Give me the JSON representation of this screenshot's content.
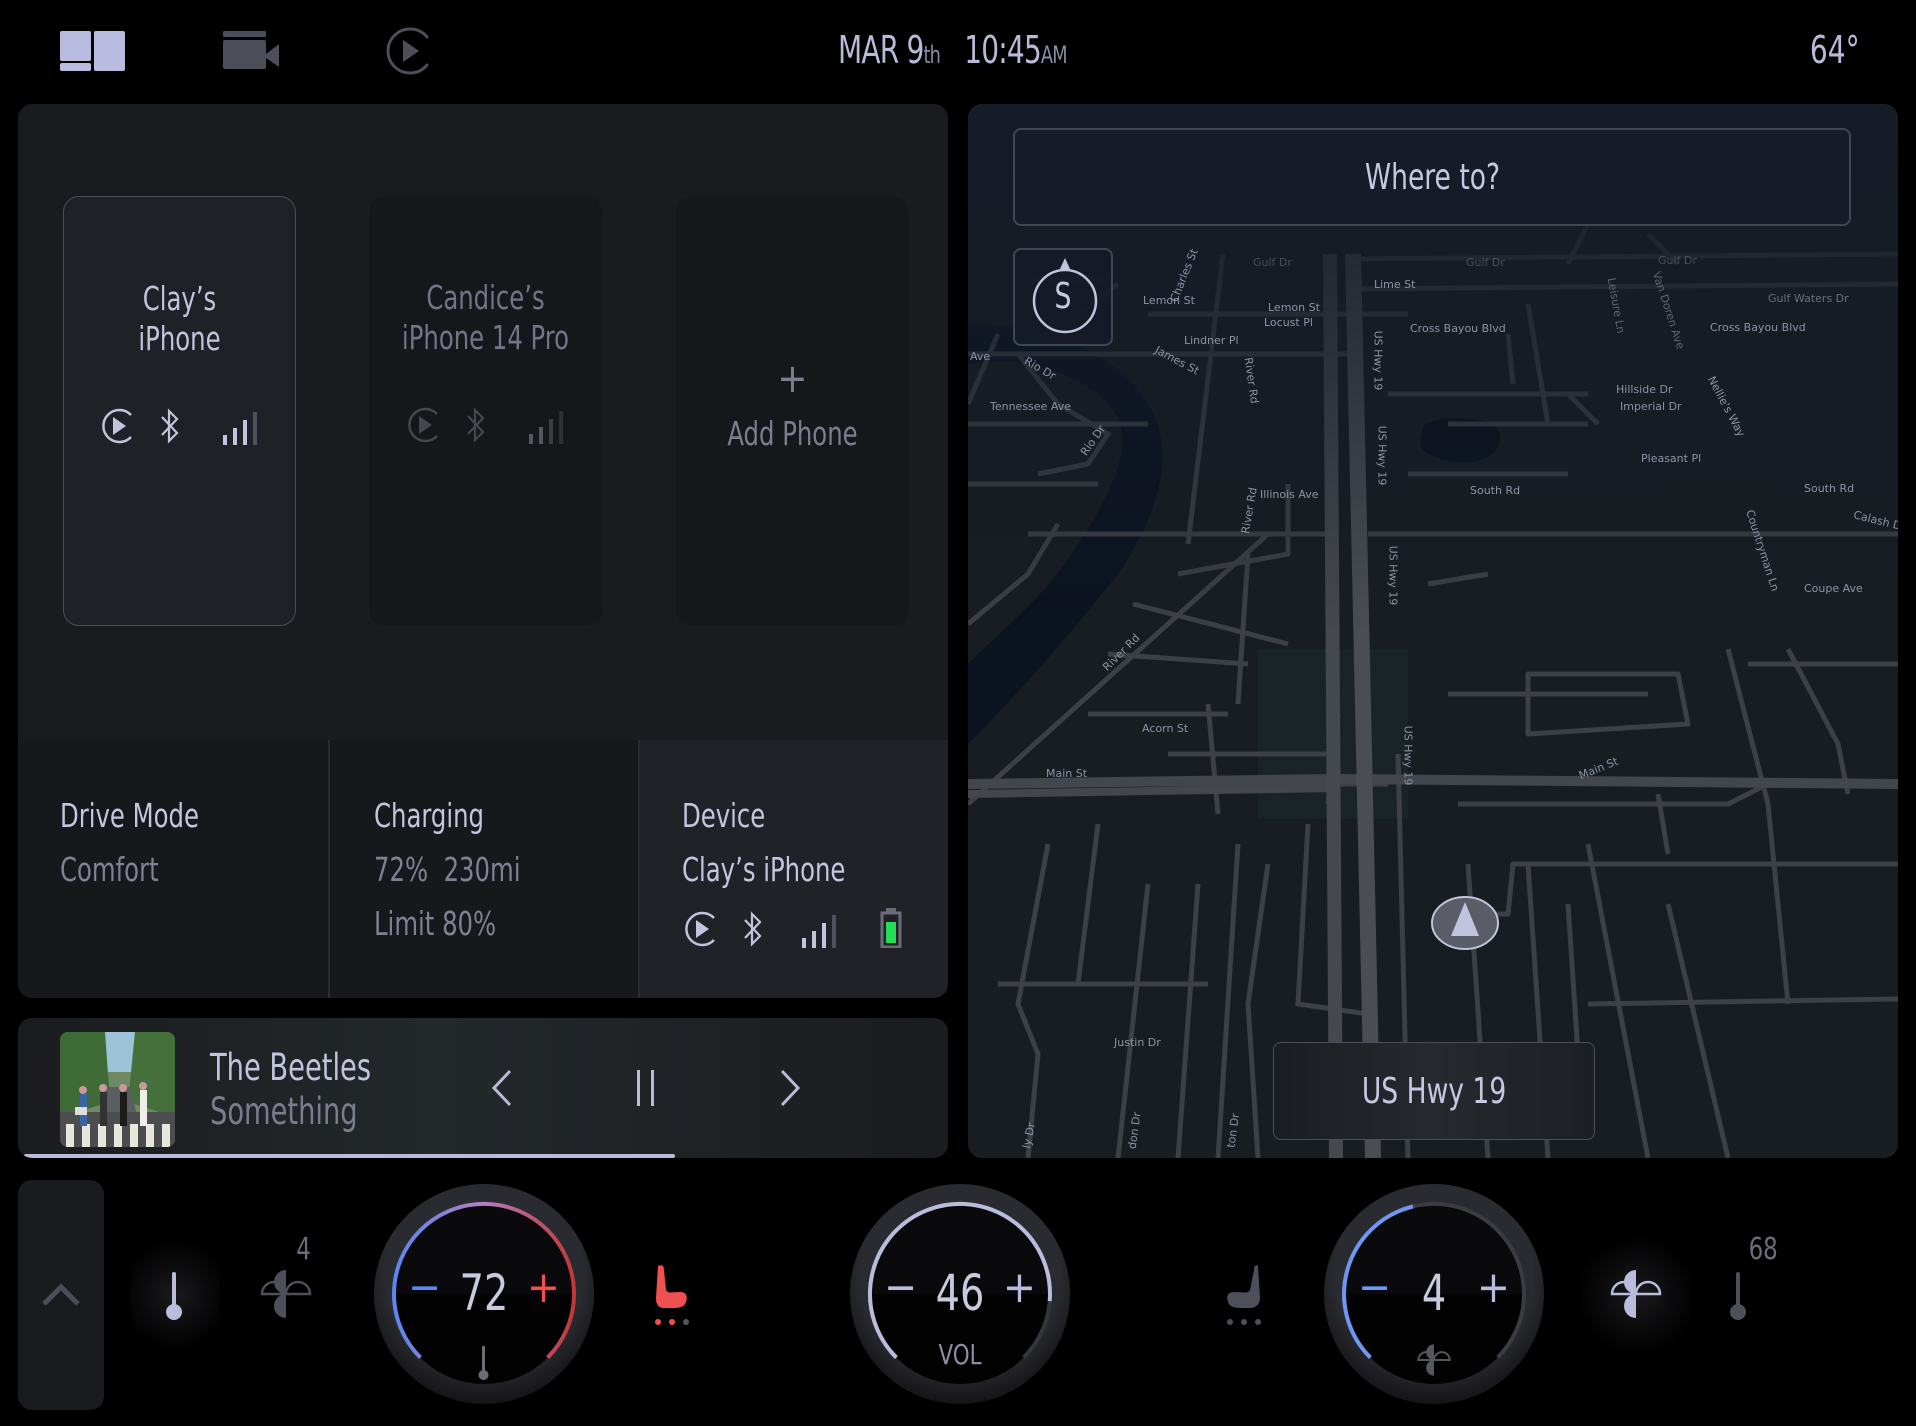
{
  "topbar": {
    "icons": [
      {
        "name": "dashboard-layout-icon",
        "active": true
      },
      {
        "name": "video-camera-icon",
        "active": false
      },
      {
        "name": "media-play-icon",
        "active": false
      }
    ],
    "date_month_day": "MAR 9",
    "date_suffix": "th",
    "time": "10:45",
    "time_suffix": "AM",
    "outside_temp": "64°"
  },
  "phones": [
    {
      "name_line1": "Clay’s",
      "name_line2": "iPhone",
      "state": "active",
      "icons": [
        "carplay-icon",
        "bluetooth-icon",
        "signal-icon"
      ]
    },
    {
      "name_line1": "Candice’s",
      "name_line2": "iPhone 14 Pro",
      "state": "inactive",
      "icons": [
        "carplay-icon",
        "bluetooth-icon",
        "signal-icon"
      ]
    },
    {
      "add_icon": "+",
      "add_label": "Add Phone"
    }
  ],
  "info": {
    "drive_mode": {
      "title": "Drive Mode",
      "value": "Comfort"
    },
    "charging": {
      "title": "Charging",
      "percent": "72%",
      "range": "230mi",
      "limit": "Limit 80%"
    },
    "device": {
      "title": "Device",
      "name": "Clay’s iPhone",
      "battery_color": "#22dd55"
    }
  },
  "media": {
    "artist": "The Beetles",
    "song": "Something",
    "progress": 0.7,
    "prev_icon": "chevron-left-icon",
    "pause_icon": "pause-icon",
    "next_icon": "chevron-right-icon"
  },
  "map": {
    "search_placeholder": "Where to?",
    "compass_label": "S",
    "current_street": "US Hwy 19",
    "labels": {
      "lemon_st_1": "Lemon St",
      "lemon_st_2": "Lemon St",
      "charles_st": "Charles St",
      "lime_st": "Lime St",
      "locust_pl": "Locust Pl",
      "lindner_pl": "Lindner Pl",
      "james_st": "James St",
      "gulf_dr_1": "Gulf Dr",
      "gulf_dr_2": "Gulf Dr",
      "gulf_dr_3": "Gulf Dr",
      "leisure_ln": "Leisure Ln",
      "van_doren_ave": "Van Doren Ave",
      "gulf_waters_dr": "Gulf Waters Dr",
      "cross_bayou_1": "Cross Bayou Blvd",
      "cross_bayou_2": "Cross Bayou Blvd",
      "ave": "Ave",
      "rio_dr_1": "Rio Dr",
      "rio_dr_2": "Rio Dr",
      "tennessee_ave": "Tennessee Ave",
      "river_rd_1": "River Rd",
      "river_rd_2": "River Rd",
      "river_rd_3": "River Rd",
      "us_hwy_19_a": "US Hwy 19",
      "us_hwy_19_b": "US Hwy 19",
      "us_hwy_19_c": "US Hwy 19",
      "us_hwy_19_d": "US Hwy 19",
      "hillside_dr": "Hillside Dr",
      "imperial_dr": "Imperial Dr",
      "nellies_way": "Nellie's Way",
      "pleasant_pl": "Pleasant Pl",
      "illinois_ave": "Illinois Ave",
      "south_rd_1": "South Rd",
      "south_rd_2": "South Rd",
      "calash_dr": "Calash D",
      "countryman_ln": "Countryman Ln",
      "coupe_ave": "Coupe Ave",
      "acorn_st": "Acorn St",
      "main_st_1": "Main St",
      "main_st_2": "Main St",
      "justin_dr": "Justin Dr",
      "bottom_1": "ly Dr",
      "bottom_2": "don Dr",
      "bottom_3": "ton Dr"
    }
  },
  "climate": {
    "collapse_icon": "chevron-up-icon",
    "driver": {
      "fan_level": "4",
      "temp": "72",
      "minus": "−",
      "plus": "+",
      "heat_color": "#f05050",
      "cool_color": "#5a86f0",
      "seat_heat_level": 2
    },
    "volume": {
      "value": "46",
      "label": "VOL",
      "minus": "−",
      "plus": "+",
      "level": 0.85
    },
    "fan": {
      "value": "4",
      "minus": "−",
      "plus": "+",
      "level": 0.45
    },
    "passenger": {
      "temp": "68",
      "seat_heat_level": 0
    }
  }
}
